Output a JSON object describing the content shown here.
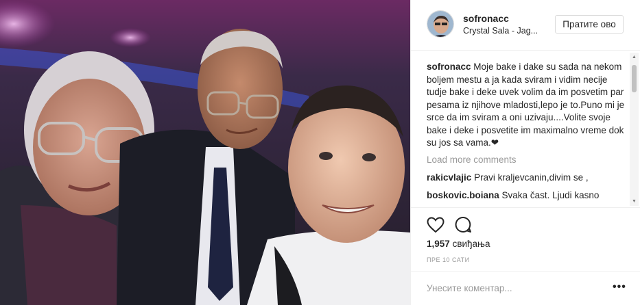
{
  "post": {
    "image_alt": "Selfie photo"
  },
  "header": {
    "username": "sofronacc",
    "location": "Crystal Sala - Jag...",
    "follow_label": "Пратите ово"
  },
  "caption": {
    "username": "sofronacc",
    "text": "Moje bake i dake su sada na nekom boljem mestu a ja kada sviram i vidim necije tudje bake i deke uvek volim da im posvetim par pesama iz njihove mladosti,lepo je to.Puno mi je srce da im sviram a oni uzivaju....Volite svoje bake i deke i posvetite im maximalno vreme dok su jos sa vama.❤"
  },
  "load_more_label": "Load more comments",
  "comments": [
    {
      "username": "rakicvlajic",
      "text": "Pravi kraljevcanin,divim se ,"
    },
    {
      "username": "boskovic.boiana",
      "text": "Svaka čast. Ljudi kasno"
    }
  ],
  "likes": {
    "count": "1,957",
    "label": "свиђања"
  },
  "time_label": "ПРЕ 10 САТИ",
  "comment_input": {
    "placeholder": "Унесите коментар..."
  },
  "more_label": "•••",
  "icons": {
    "like": "heart-icon",
    "comment": "comment-bubble-icon",
    "more": "more-options-icon"
  }
}
